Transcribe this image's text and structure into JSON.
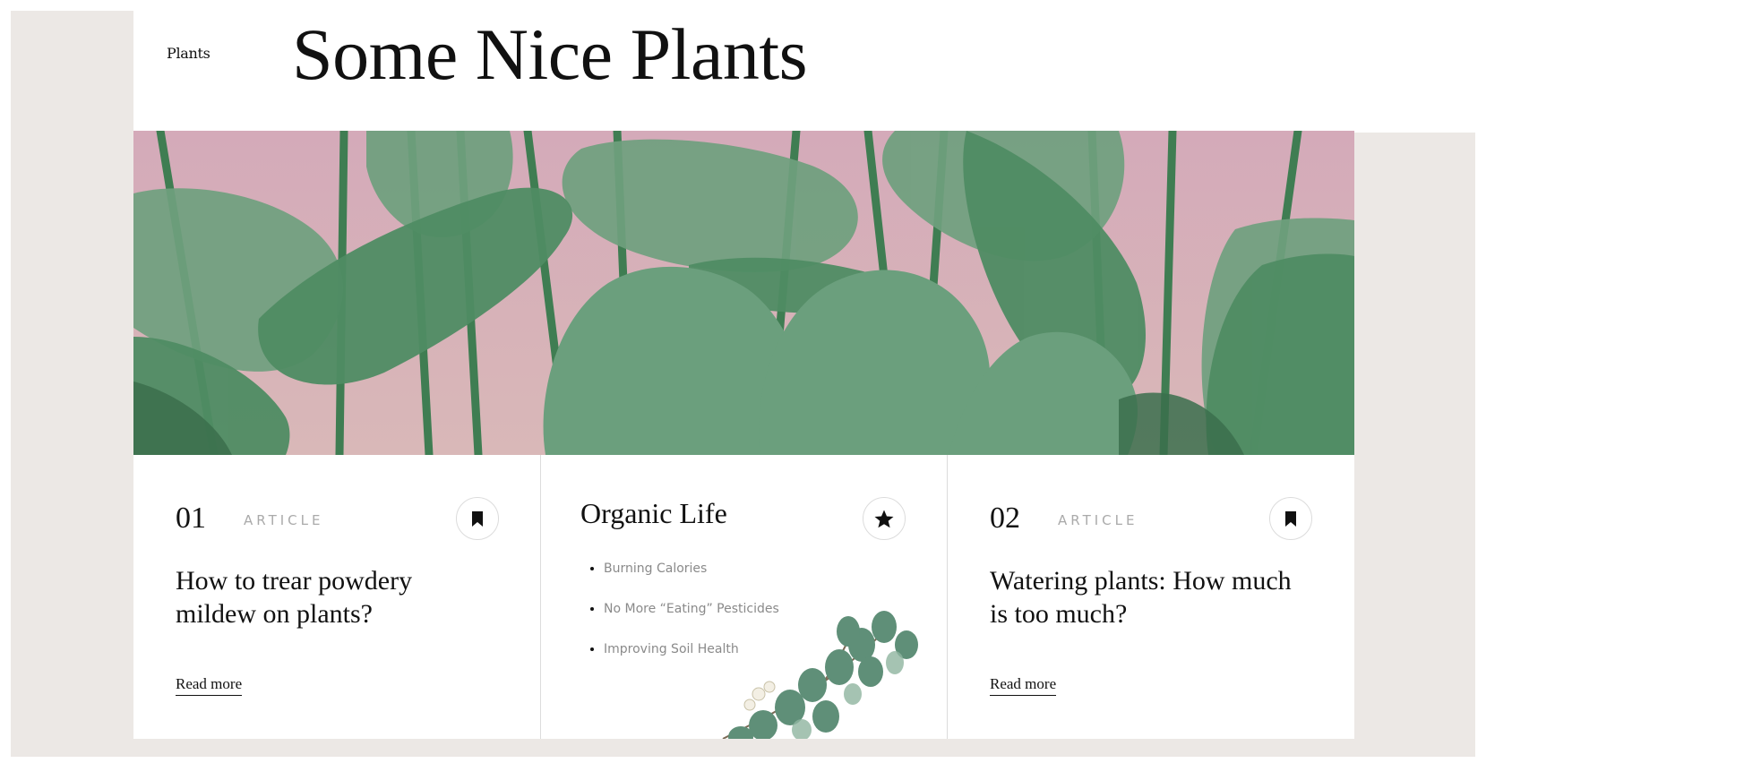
{
  "header": {
    "brand": "Plants",
    "title": "Some Nice Plants"
  },
  "hero": {
    "image": "watercolor-green-leaves-on-pink",
    "colors": {
      "sky": "#d3aebb",
      "leaf": "#5e9770",
      "leaf_dark": "#3f7551"
    }
  },
  "cards": [
    {
      "number": "01",
      "kind": "ARTICLE",
      "title": "How to trear powdery mildew on plants?",
      "link": "Read more",
      "icon": "bookmark-icon"
    },
    {
      "title": "Organic Life",
      "icon": "star-icon",
      "items": [
        "Burning Calories",
        "No More “Eating” Pesticides",
        "Improving Soil Health"
      ],
      "image": "eucalyptus-branch"
    },
    {
      "number": "02",
      "kind": "ARTICLE",
      "title": "Watering plants: How much is too much?",
      "link": "Read more",
      "icon": "bookmark-icon"
    }
  ],
  "colors": {
    "backdrop": "#ece8e5",
    "text": "#111111",
    "muted": "#aaaaaa"
  }
}
